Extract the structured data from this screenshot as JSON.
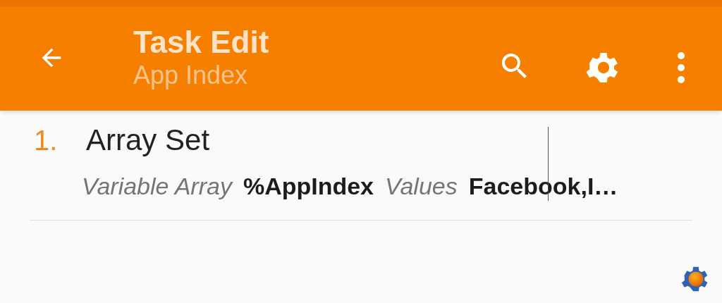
{
  "app_bar": {
    "title": "Task Edit",
    "subtitle": "App Index"
  },
  "actions": [
    {
      "number": "1.",
      "name": "Array Set",
      "params": [
        {
          "label": "Variable Array",
          "value": "%AppIndex"
        },
        {
          "label": "Values",
          "value": "Facebook,I…"
        }
      ]
    }
  ]
}
